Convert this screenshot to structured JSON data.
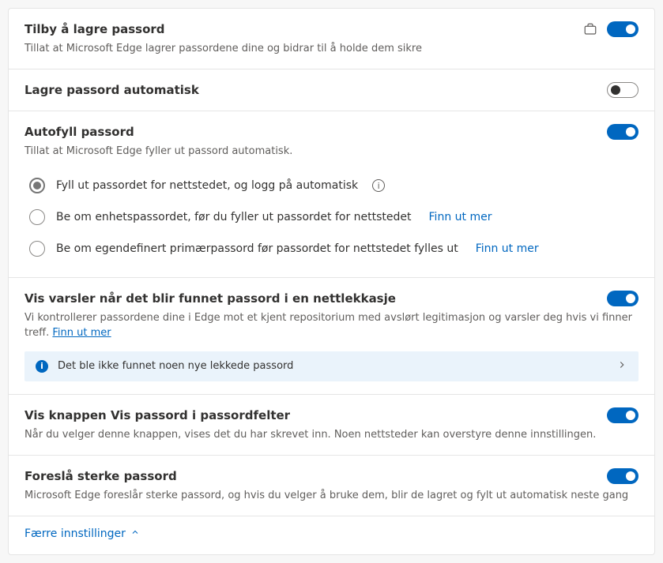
{
  "sections": {
    "offer_save": {
      "title": "Tilby å lagre passord",
      "desc": "Tillat at Microsoft Edge lagrer passordene dine og bidrar til å holde dem sikre",
      "toggle_on": true
    },
    "auto_save": {
      "title": "Lagre passord automatisk",
      "toggle_on": false
    },
    "autofill": {
      "title": "Autofyll passord",
      "desc": "Tillat at Microsoft Edge fyller ut passord automatisk.",
      "toggle_on": true,
      "options": [
        {
          "label": "Fyll ut passordet for nettstedet, og logg på automatisk",
          "selected": true,
          "info": true
        },
        {
          "label": "Be om enhetspassordet, før du fyller ut passordet for nettstedet",
          "selected": false,
          "link": "Finn ut mer"
        },
        {
          "label": "Be om egendefinert primærpassord før passordet for nettstedet fylles ut",
          "selected": false,
          "link": "Finn ut mer"
        }
      ]
    },
    "leak_alerts": {
      "title": "Vis varsler når det blir funnet passord i en nettlekkasje",
      "desc": "Vi kontrollerer passordene dine i Edge mot et kjent repositorium med avslørt legitimasjon og varsler deg hvis vi finner treff.",
      "desc_link": "Finn ut mer",
      "toggle_on": true,
      "banner": "Det ble ikke funnet noen nye lekkede passord"
    },
    "reveal_button": {
      "title": "Vis knappen Vis passord i passordfelter",
      "desc": "Når du velger denne knappen, vises det du har skrevet inn. Noen nettsteder kan overstyre denne innstillingen.",
      "toggle_on": true
    },
    "suggest_strong": {
      "title": "Foreslå sterke passord",
      "desc": "Microsoft Edge foreslår sterke passord, og hvis du velger å bruke dem, blir de lagret og fylt ut automatisk neste gang",
      "toggle_on": true
    }
  },
  "collapse_label": "Færre innstillinger"
}
